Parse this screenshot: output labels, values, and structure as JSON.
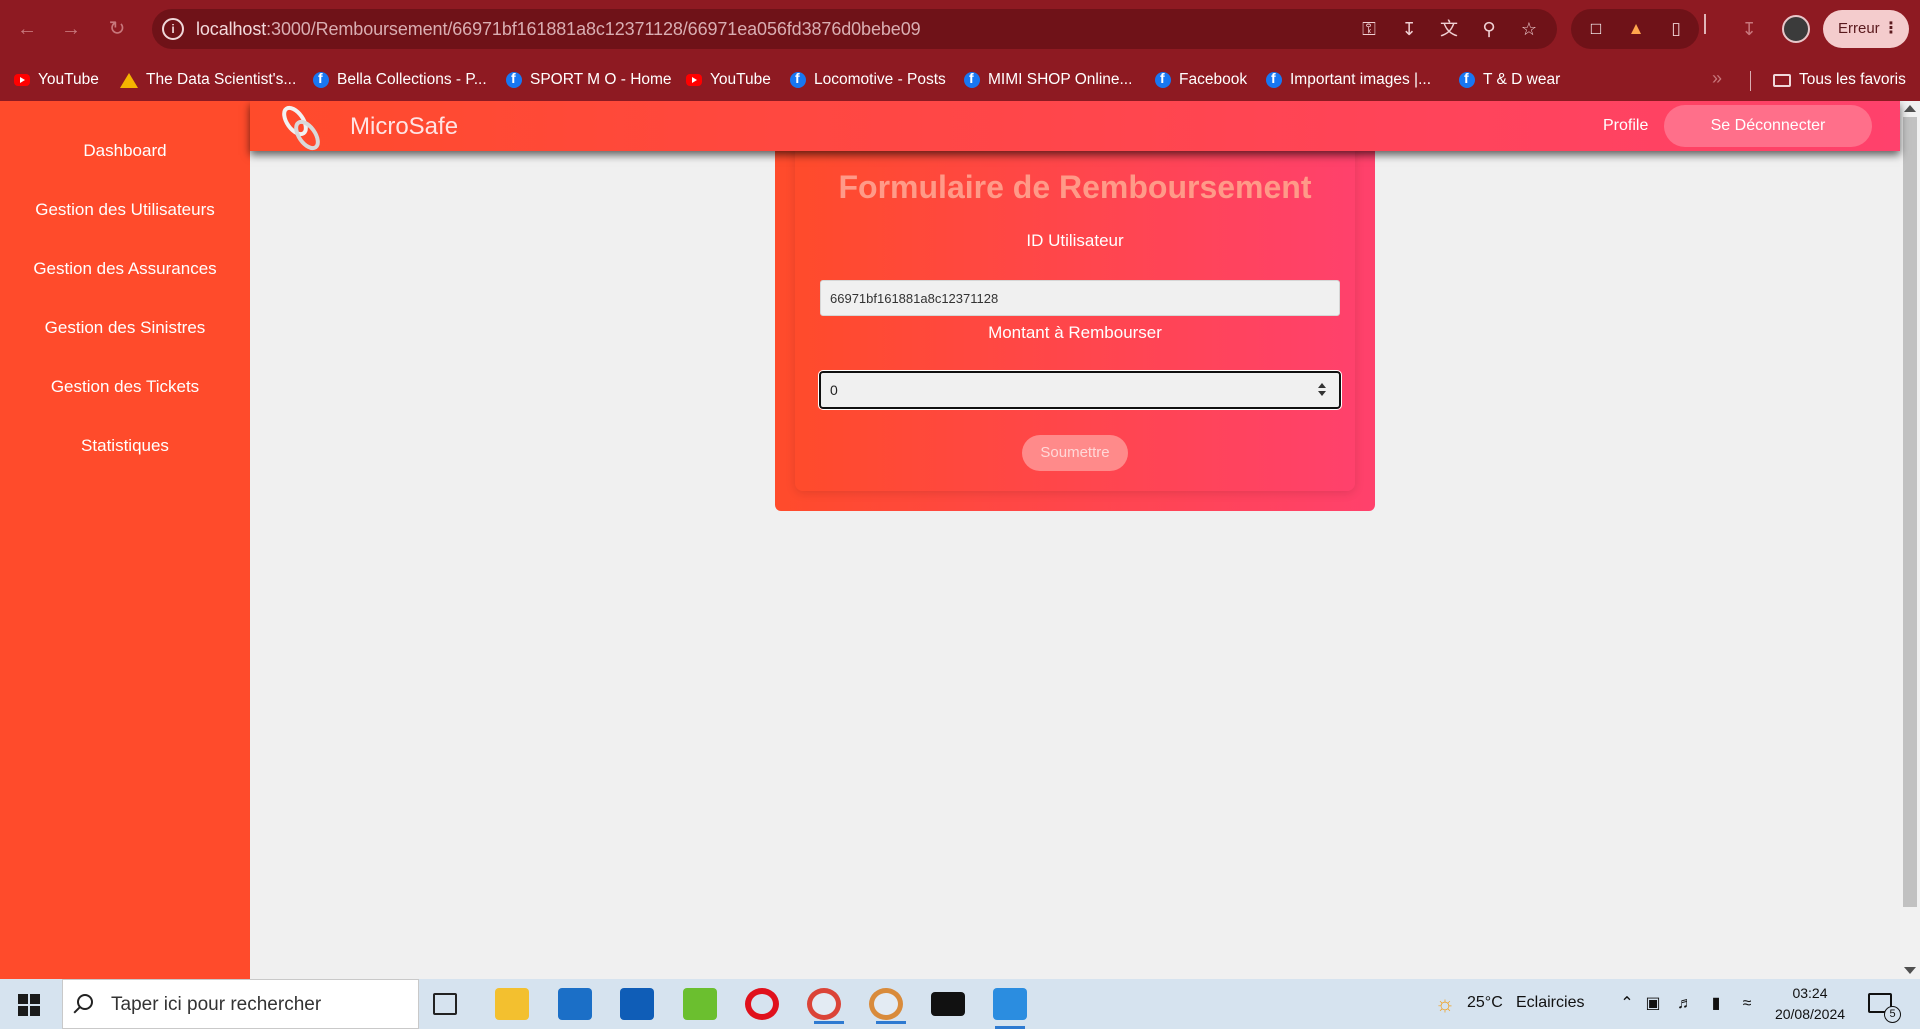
{
  "browser": {
    "url_host": "localhost",
    "url_rest": ":3000/Remboursement/66971bf161881a8c12371128/66971ea056fd3876d0bebe09",
    "profile_chip": "Erreur",
    "bookmarks": [
      {
        "label": "YouTube",
        "icon": "youtube-icon"
      },
      {
        "label": "The Data Scientist's...",
        "icon": "google-drive-icon"
      },
      {
        "label": "Bella Collections - P...",
        "icon": "facebook-icon"
      },
      {
        "label": "SPORT M O - Home",
        "icon": "facebook-icon"
      },
      {
        "label": "YouTube",
        "icon": "youtube-icon"
      },
      {
        "label": "Locomotive - Posts",
        "icon": "facebook-icon"
      },
      {
        "label": "MIMI SHOP Online...",
        "icon": "facebook-icon"
      },
      {
        "label": "Facebook",
        "icon": "facebook-icon"
      },
      {
        "label": "Important images |...",
        "icon": "facebook-icon"
      },
      {
        "label": "T & D wear",
        "icon": "facebook-icon"
      }
    ],
    "bookmarks_more": "»",
    "all_bookmarks": "Tous les favoris"
  },
  "sidebar": {
    "items": [
      {
        "label": "Dashboard"
      },
      {
        "label": "Gestion des Utilisateurs"
      },
      {
        "label": "Gestion des Assurances"
      },
      {
        "label": "Gestion des Sinistres"
      },
      {
        "label": "Gestion des Tickets"
      },
      {
        "label": "Statistiques"
      }
    ]
  },
  "header": {
    "brand": "MicroSafe",
    "profile": "Profile",
    "logout": "Se Déconnecter"
  },
  "form": {
    "title": "Formulaire de Remboursement",
    "user_id_label": "ID Utilisateur",
    "user_id_value": "66971bf161881a8c12371128",
    "amount_label": "Montant à Rembourser",
    "amount_value": "0",
    "submit": "Soumettre"
  },
  "taskbar": {
    "search_placeholder": "Taper ici pour rechercher",
    "weather_temp": "25°C",
    "weather_text": "Eclaircies",
    "time": "03:24",
    "date": "20/08/2024",
    "notifications": "5"
  },
  "colors": {
    "chrome": "#8e1a22",
    "sidebar": "#ff4b2b",
    "gradient_end": "#ff416c"
  }
}
